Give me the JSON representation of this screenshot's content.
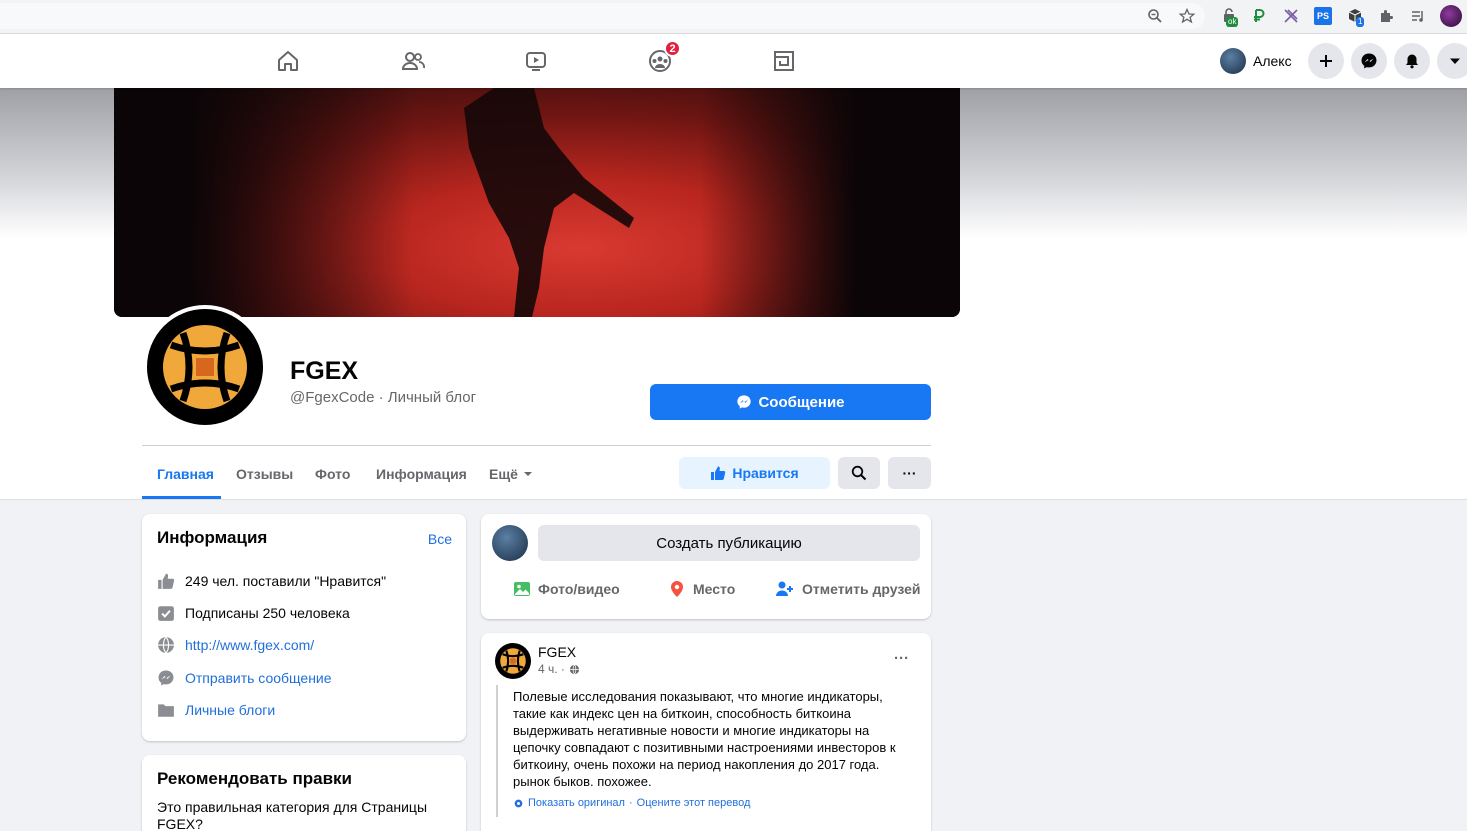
{
  "browser": {
    "icons": [
      "zoom-icon",
      "star-icon",
      "ok-extension-icon",
      "ruble-extension-icon",
      "x-extension-icon",
      "ps-extension-icon",
      "box-extension-icon",
      "puzzle-icon",
      "reading-list-icon",
      "profile-icon"
    ],
    "ext_ok_badge": "ok",
    "ext_ps_label": "PS",
    "ext_box_badge": "1"
  },
  "nav": {
    "groups_badge": "2",
    "user_name": "Алекс"
  },
  "page": {
    "name": "FGEX",
    "handle": "@FgexCode · Личный блог",
    "message_button": "Сообщение",
    "tabs": [
      "Главная",
      "Отзывы",
      "Фото",
      "Информация",
      "Ещё"
    ],
    "active_tab": 0,
    "like_button": "Нравится",
    "more_label": "···"
  },
  "info_card": {
    "title": "Информация",
    "see_all": "Все",
    "rows": [
      {
        "icon": "thumbs-up-icon",
        "text": "249 чел. поставили \"Нравится\"",
        "link": false
      },
      {
        "icon": "checkbox-icon",
        "text": "Подписаны 250 человека",
        "link": false
      },
      {
        "icon": "globe-icon",
        "text": "http://www.fgex.com/",
        "link": true
      },
      {
        "icon": "messenger-icon",
        "text": "Отправить сообщение",
        "link": true
      },
      {
        "icon": "folder-icon",
        "text": "Личные блоги",
        "link": true
      }
    ]
  },
  "suggest_card": {
    "title": "Рекомендовать правки",
    "text": "Это правильная категория для Страницы FGEX?"
  },
  "composer": {
    "placeholder": "Создать публикацию",
    "actions": [
      "Фото/видео",
      "Место",
      "Отметить друзей"
    ]
  },
  "post": {
    "author": "FGEX",
    "time": "4 ч. ·",
    "text": "Полевые исследования показывают, что многие индикаторы, такие как индекс цен на биткоин, способность биткоина выдерживать негативные новости и многие индикаторы на цепочку совпадают с позитивными настроениями инвесторов к биткоину, очень похожи на период накопления до 2017 года. рынок быков. похожее.",
    "translate_show": "Показать оригинал",
    "translate_rate": "Оцените этот перевод",
    "menu": "···"
  },
  "colors": {
    "fb_blue": "#1877f2",
    "link_blue": "#216fdb",
    "badge_red": "#e41e3f",
    "logo_orange": "#f0a83a"
  }
}
